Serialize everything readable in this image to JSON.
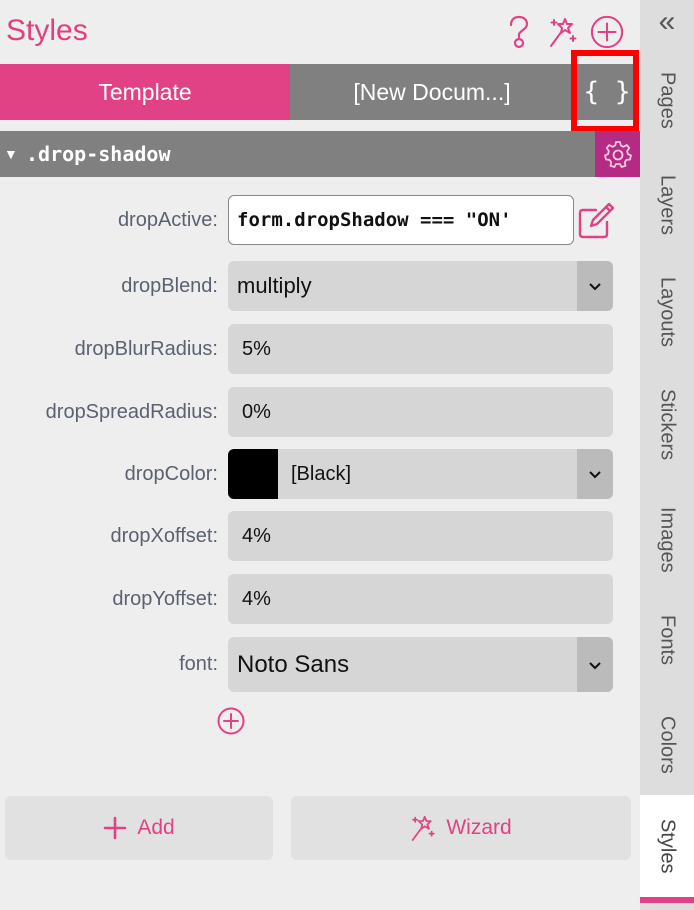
{
  "header": {
    "title": "Styles",
    "icons": [
      "help-icon",
      "wand-icon",
      "add-circle-icon"
    ]
  },
  "tabs": [
    {
      "label": "Template",
      "active": true
    },
    {
      "label": "[New Docum...]",
      "active": false
    },
    {
      "label": "{ }",
      "icon": "code-braces-icon"
    }
  ],
  "section": {
    "name": ".drop-shadow",
    "expanded": true
  },
  "properties": {
    "dropActive": {
      "label": "dropActive:",
      "value": "form.dropShadow === \"ON'"
    },
    "dropBlend": {
      "label": "dropBlend:",
      "value": "multiply"
    },
    "dropBlurRadius": {
      "label": "dropBlurRadius:",
      "value": "5%"
    },
    "dropSpreadRadius": {
      "label": "dropSpreadRadius:",
      "value": "0%"
    },
    "dropColor": {
      "label": "dropColor:",
      "value": "[Black]",
      "swatch": "#000000"
    },
    "dropXoffset": {
      "label": "dropXoffset:",
      "value": "4%"
    },
    "dropYoffset": {
      "label": "dropYoffset:",
      "value": "4%"
    },
    "font": {
      "label": "font:",
      "value": "Noto Sans"
    }
  },
  "buttons": {
    "add": "Add",
    "wizard": "Wizard"
  },
  "sidebar": {
    "collapse_glyph": "«",
    "tabs": [
      "Pages",
      "Layers",
      "Layouts",
      "Stickers",
      "Images",
      "Fonts",
      "Colors",
      "Styles"
    ],
    "active": "Styles"
  },
  "colors": {
    "accent": "#e04285",
    "gear_bg": "#b52a82",
    "tab_inactive": "#808080",
    "highlight": "#ff0000"
  }
}
